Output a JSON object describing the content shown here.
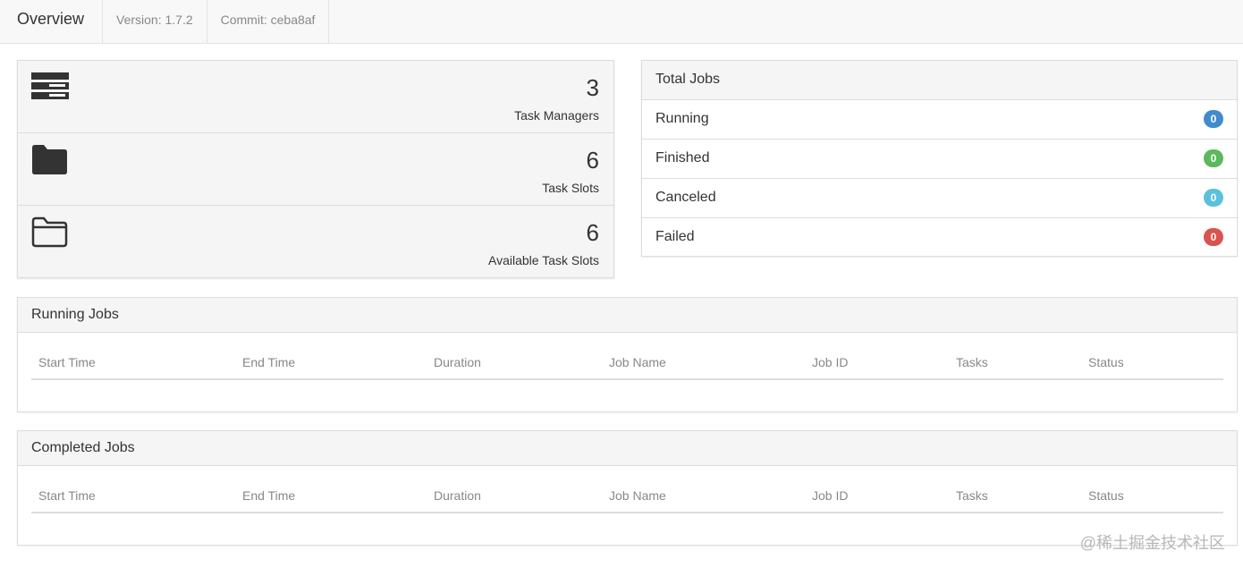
{
  "topbar": {
    "title": "Overview",
    "version": "Version: 1.7.2",
    "commit": "Commit: ceba8af"
  },
  "overview": [
    {
      "icon": "server-icon",
      "value": "3",
      "label": "Task Managers"
    },
    {
      "icon": "folder-filled-icon",
      "value": "6",
      "label": "Task Slots"
    },
    {
      "icon": "folder-open-icon",
      "value": "6",
      "label": "Available Task Slots"
    }
  ],
  "total_jobs": {
    "title": "Total Jobs",
    "rows": [
      {
        "label": "Running",
        "count": "0",
        "color": "#428bca"
      },
      {
        "label": "Finished",
        "count": "0",
        "color": "#5cb85c"
      },
      {
        "label": "Canceled",
        "count": "0",
        "color": "#5bc0de"
      },
      {
        "label": "Failed",
        "count": "0",
        "color": "#d9534f"
      }
    ]
  },
  "running_jobs": {
    "title": "Running Jobs",
    "columns": [
      "Start Time",
      "End Time",
      "Duration",
      "Job Name",
      "Job ID",
      "Tasks",
      "Status"
    ]
  },
  "completed_jobs": {
    "title": "Completed Jobs",
    "columns": [
      "Start Time",
      "End Time",
      "Duration",
      "Job Name",
      "Job ID",
      "Tasks",
      "Status"
    ]
  },
  "watermark": "@稀土掘金技术社区"
}
